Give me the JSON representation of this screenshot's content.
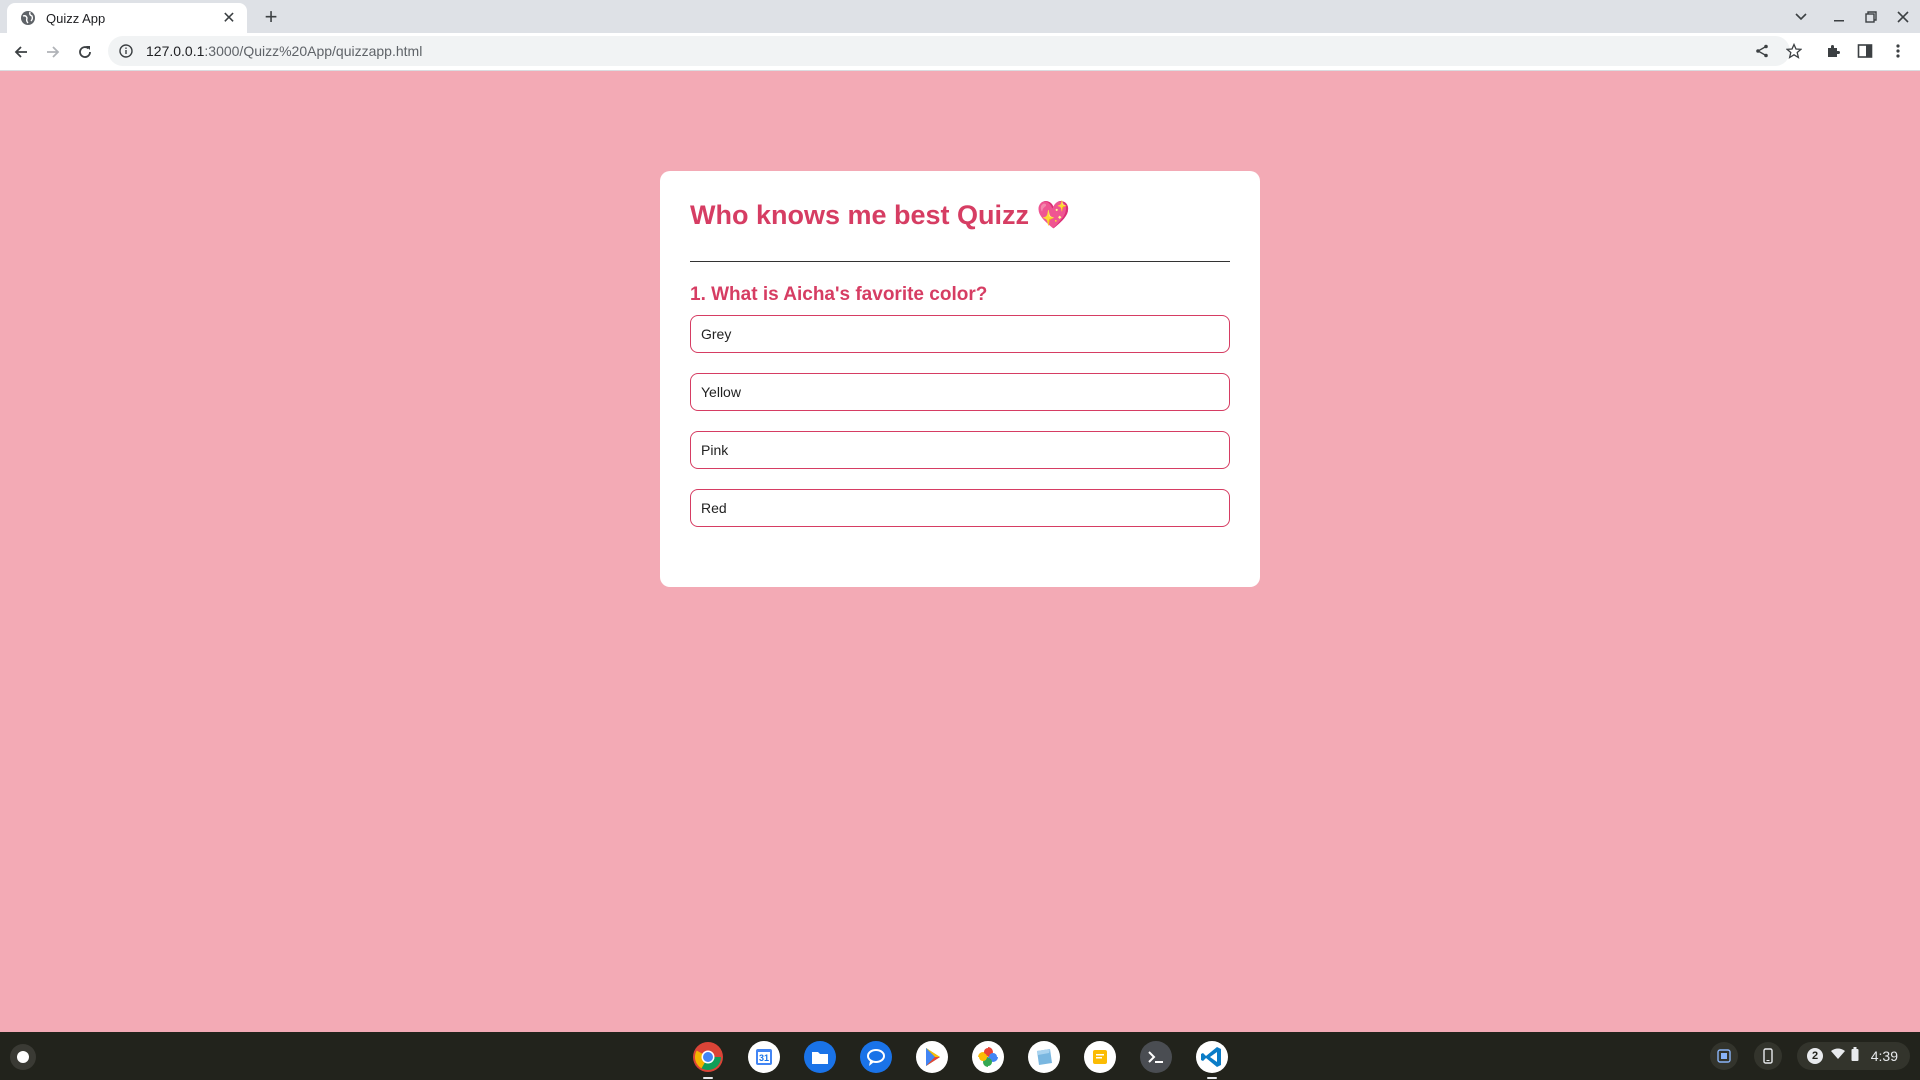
{
  "browser": {
    "tab_title": "Quizz App",
    "url_host": "127.0.0.1",
    "url_path": ":3000/Quizz%20App/quizzapp.html"
  },
  "quiz": {
    "title": "Who knows me best Quizz 💖",
    "question": "1. What is Aicha's favorite color?",
    "answers": [
      "Grey",
      "Yellow",
      "Pink",
      "Red"
    ]
  },
  "colors": {
    "page_background": "#f3aab5",
    "accent": "#d63d63"
  },
  "shelf": {
    "apps": [
      "chrome-icon",
      "calendar-icon",
      "files-icon",
      "messages-icon",
      "play-store-icon",
      "photos-icon",
      "cube-app-icon",
      "keep-notes-icon",
      "terminal-icon",
      "vscode-icon"
    ],
    "calendar_day": "31",
    "notification_count": "2",
    "time": "4:39"
  }
}
